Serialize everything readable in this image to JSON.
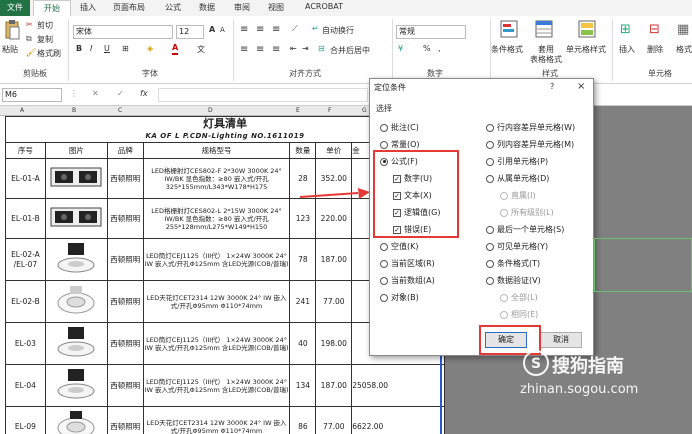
{
  "tabs": [
    "文件",
    "开始",
    "插入",
    "页面布局",
    "公式",
    "数据",
    "审阅",
    "视图",
    "ACROBAT"
  ],
  "clipboard": {
    "paste": "粘贴",
    "cut": "剪切",
    "copy": "复制",
    "format_painter": "格式刷",
    "group": "剪贴板"
  },
  "font": {
    "name": "宋体",
    "size": "12",
    "group": "字体",
    "bold": "B",
    "italic": "I",
    "underline": "U",
    "grow": "A",
    "shrink": "A"
  },
  "alignment": {
    "wrap": "自动换行",
    "merge": "合并后居中",
    "group": "对齐方式"
  },
  "number": {
    "format": "常规",
    "percent": "%",
    "comma": ",",
    "group": "数字"
  },
  "styles": {
    "conditional": "条件格式",
    "table1": "套用",
    "table2": "表格格式",
    "cell": "单元格样式",
    "group": "样式"
  },
  "cells": {
    "insert": "插入",
    "delete": "删除",
    "format": "格式",
    "group": "单元格"
  },
  "formula_bar": {
    "name_box": "M6",
    "fx": "fx"
  },
  "columns": [
    "A",
    "B",
    "C",
    "D",
    "E",
    "F",
    "G"
  ],
  "sheet": {
    "title": "灯具清单",
    "subtitle": "KA OF L P.CDN-Lighting NO.1611019",
    "headers": [
      "序号",
      "图片",
      "品牌",
      "规格型号",
      "数量",
      "单价",
      "金"
    ],
    "rows": [
      {
        "no": "EL-01-A",
        "brand": "西顿照明",
        "spec": "LED格栅射灯CES802-F 2*30W 3000K 24° IW/BK 显色指数：≥80 嵌入式/开孔325*155mm/L343*W178*H175",
        "qty": "28",
        "price": "352.00",
        "amount": ""
      },
      {
        "no": "EL-01-B",
        "brand": "西顿照明",
        "spec": "LED格栅射灯CES802-L 2*15W 3000K 24° IW/BK 显色指数：≥80 嵌入式/开孔255*128mm/L275*W149*H150",
        "qty": "123",
        "price": "220.00",
        "amount": ""
      },
      {
        "no": "EL-02-A /EL-07",
        "brand": "西顿照明",
        "spec": "LED筒灯CEJ1125（III代） 1×24W 3000K 24° IW 嵌入式/开孔Φ125mm 含LED光源(COB/普瑞)",
        "qty": "78",
        "price": "187.00",
        "amount": "14"
      },
      {
        "no": "EL-02-B",
        "brand": "西顿照明",
        "spec": "LED天花灯CET2314 12W 3000K 24° IW 嵌入式/开孔Φ95mm Φ110*74mm",
        "qty": "241",
        "price": "77.00",
        "amount": "18"
      },
      {
        "no": "EL-03",
        "brand": "西顿照明",
        "spec": "LED筒灯CEJ1125（III代） 1×24W 3000K 24° IW 嵌入式/开孔Φ125mm 含LED光源(COB/普瑞)",
        "qty": "40",
        "price": "198.00",
        "amount": "7"
      },
      {
        "no": "EL-04",
        "brand": "西顿照明",
        "spec": "LED筒灯CEJ1125（III代） 1×24W 3000K 24° IW 嵌入式/开孔Φ125mm 含LED光源(COB/普瑞)",
        "qty": "134",
        "price": "187.00",
        "amount": "25058.00"
      },
      {
        "no": "EL-09",
        "brand": "西顿照明",
        "spec": "LED天花灯CET2314 12W 3000K 24° IW 嵌入式/开孔Φ95mm Φ110*74mm",
        "qty": "86",
        "price": "77.00",
        "amount": "6622.00"
      }
    ]
  },
  "dialog": {
    "title": "定位条件",
    "help": "?",
    "close": "×",
    "section": "选择",
    "left_options": [
      "批注(C)",
      "常量(O)",
      "公式(F)",
      "数字(U)",
      "文本(X)",
      "逻辑值(G)",
      "错误(E)",
      "空值(K)",
      "当前区域(R)",
      "当前数组(A)",
      "对象(B)"
    ],
    "right_options": [
      "行内容差异单元格(W)",
      "列内容差异单元格(M)",
      "引用单元格(P)",
      "从属单元格(D)",
      "直属(I)",
      "所有级别(L)",
      "最后一个单元格(S)",
      "可见单元格(Y)",
      "条件格式(T)",
      "数据验证(V)",
      "全部(L)",
      "相同(E)"
    ],
    "ok": "确定",
    "cancel": "取消"
  },
  "watermark": {
    "brand": "搜狗指南",
    "url": "zhinan.sogou.com"
  },
  "colors": {
    "excel_green": "#217346",
    "highlight_red": "#e53935",
    "gray_bg": "#808080"
  }
}
